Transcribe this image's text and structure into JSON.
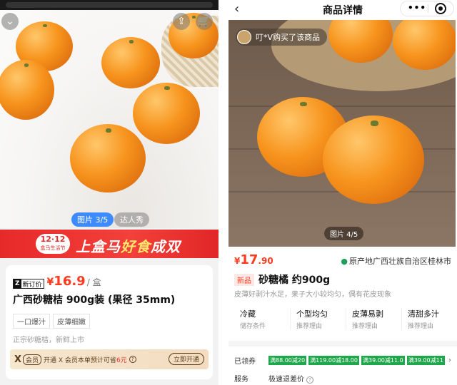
{
  "left": {
    "photo": {
      "counter": "图片 3/5",
      "review_tab": "达人秀",
      "back_icon": "chevron-down-icon",
      "share_icon": "share-icon",
      "cart_icon": "cart-icon"
    },
    "promo": {
      "badge_top": "12·12",
      "badge_bottom": "盒马生活节",
      "text_white": "上盒马",
      "text_yellow": "好食",
      "text_end": "成双"
    },
    "product": {
      "tag_z": "Z",
      "tag_label": "新订价",
      "currency": "¥",
      "price": "16.9",
      "unit": "/ 盒",
      "title": "广西砂糖桔 900g装 (果径 35mm)",
      "chips": [
        "一口爆汁",
        "皮薄细嫩"
      ],
      "subtitle": "正宗砂糖桔，新鲜上市",
      "member": {
        "x": "X",
        "vip": "会员",
        "text1": "开通 X 会员本单预计可省",
        "amount": "6元",
        "open_button": "立即开通"
      }
    }
  },
  "right": {
    "nav": {
      "title": "商品详情",
      "back_icon": "chevron-left-icon",
      "more_icon": "more-dots-icon",
      "record_icon": "record-icon"
    },
    "photo": {
      "buyer_text": "叮*V购买了该商品",
      "counter": "图片 4/5"
    },
    "price": {
      "currency": "¥",
      "int": "17",
      "dec": ".90"
    },
    "origin": "原产地广西壮族自治区桂林市",
    "new_tag": "新品",
    "name": "砂糖橘 约900g",
    "desc": "皮薄好剥汁水足，果子大小较均匀，偶有花皮现象",
    "features": [
      {
        "title": "冷藏",
        "sub": "储存条件"
      },
      {
        "title": "个型均匀",
        "sub": "推荐理由"
      },
      {
        "title": "皮薄易剥",
        "sub": "推荐理由"
      },
      {
        "title": "清甜多汁",
        "sub": "推荐理由"
      }
    ],
    "coupons_label": "已领券",
    "coupons": [
      "满88.00减20",
      "满119.00减18.00",
      "满39.00减11.0",
      "满39.00减11"
    ],
    "service_label": "服务",
    "service_value": "极速退差价"
  },
  "colors": {
    "price_red": "#ff3b1f",
    "promo_red": "#e62a2a",
    "coupon_green": "#1fa84b",
    "counter_blue": "#3d8bff"
  }
}
